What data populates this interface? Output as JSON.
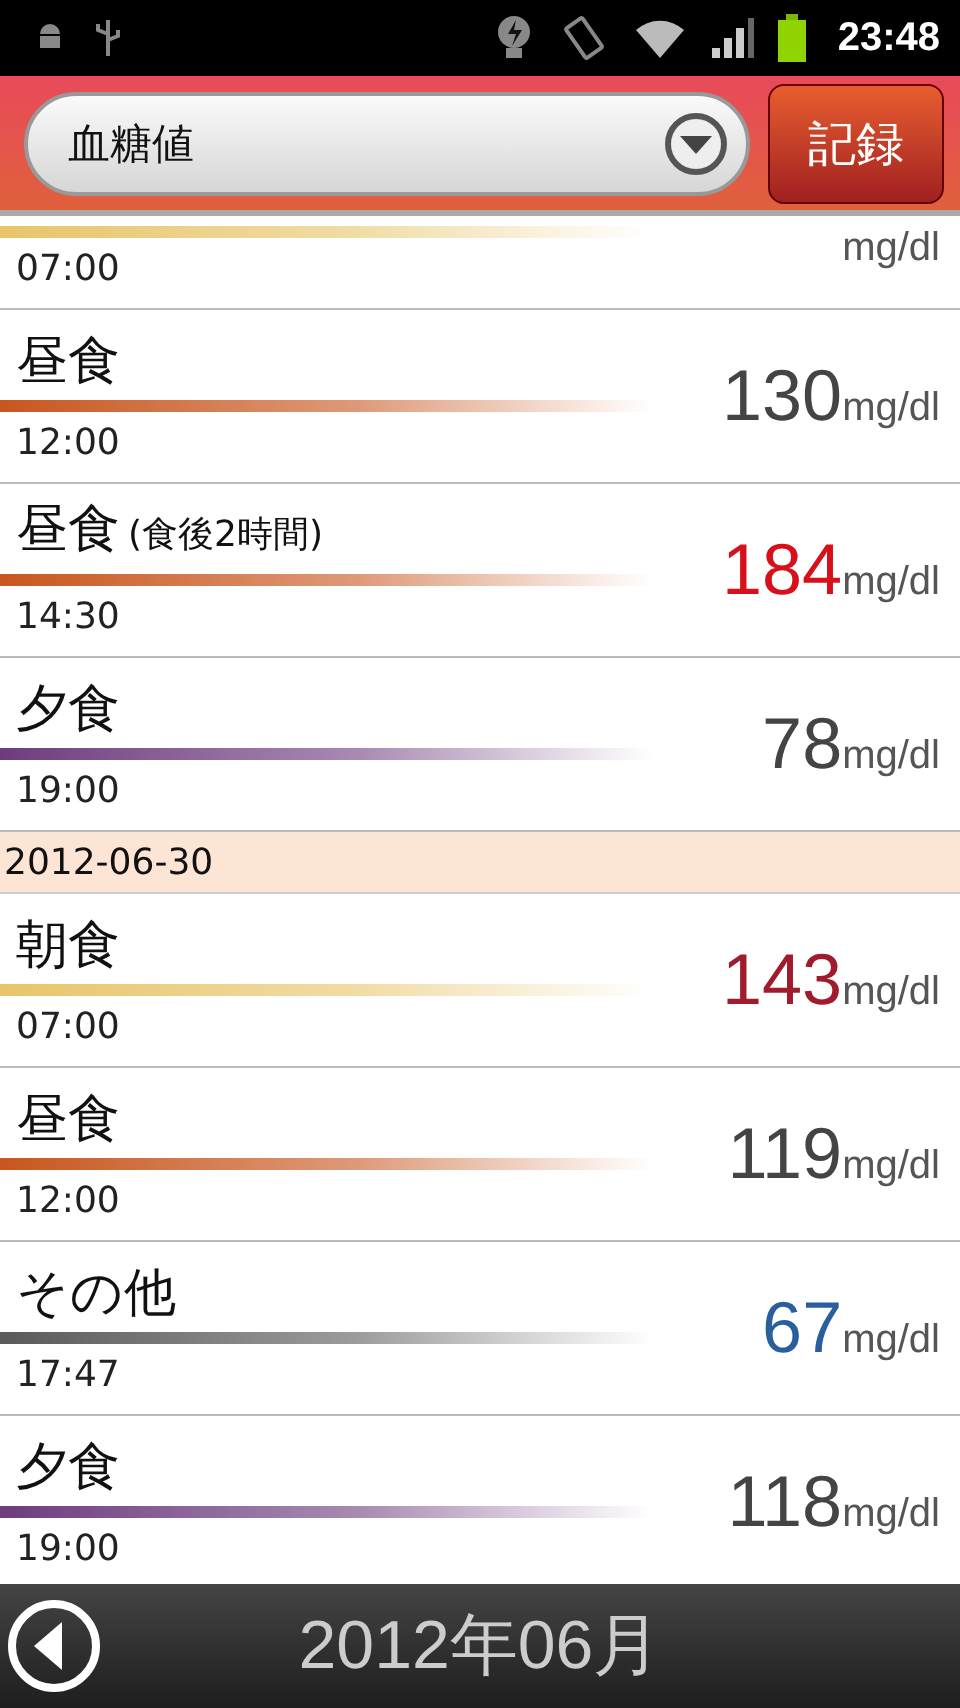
{
  "status_bar": {
    "time": "23:48"
  },
  "header": {
    "dropdown": {
      "value": "血糖値"
    },
    "record_button": "記録"
  },
  "entries": [
    {
      "kind": "entry",
      "time": "07:00",
      "unit": "mg/dl",
      "color": "#e8c56a"
    },
    {
      "kind": "entry",
      "meal": "昼食",
      "time": "12:00",
      "reading": {
        "value": "130",
        "color": "#444444"
      },
      "unit": "mg/dl",
      "color": "#c8561e"
    },
    {
      "kind": "entry",
      "meal": "昼食",
      "note": "(食後2時間)",
      "time": "14:30",
      "reading": {
        "value": "184",
        "color": "#d8101c"
      },
      "unit": "mg/dl",
      "color": "#c8561e"
    },
    {
      "kind": "entry",
      "meal": "夕食",
      "time": "19:00",
      "reading": {
        "value": "78",
        "color": "#444444"
      },
      "unit": "mg/dl",
      "color": "#6e3c7e"
    },
    {
      "kind": "date",
      "label": "2012-06-30"
    },
    {
      "kind": "entry",
      "meal": "朝食",
      "time": "07:00",
      "reading": {
        "value": "143",
        "color": "#a01c2c"
      },
      "unit": "mg/dl",
      "color": "#e8c56a"
    },
    {
      "kind": "entry",
      "meal": "昼食",
      "time": "12:00",
      "reading": {
        "value": "119",
        "color": "#444444"
      },
      "unit": "mg/dl",
      "color": "#c8561e"
    },
    {
      "kind": "entry",
      "meal": "その他",
      "time": "17:47",
      "reading": {
        "value": "67",
        "color": "#2a5f9e"
      },
      "unit": "mg/dl",
      "color": "#5a5a5a"
    },
    {
      "kind": "entry",
      "meal": "夕食",
      "time": "19:00",
      "reading": {
        "value": "118",
        "color": "#444444"
      },
      "unit": "mg/dl",
      "color": "#6e3c7e"
    }
  ],
  "footer": {
    "month": "2012年06月"
  }
}
